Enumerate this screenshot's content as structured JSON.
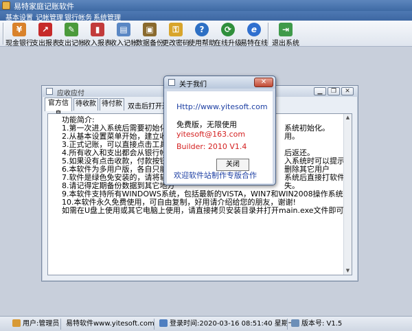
{
  "app": {
    "title": "易特家庭记账软件"
  },
  "menu": [
    "基本设置",
    "记帐管理",
    "银行帐务",
    "系统管理"
  ],
  "toolbar": [
    {
      "label": "现金银行",
      "icon": "cash-bank-icon",
      "color": "#d9822b",
      "glyph": "¥"
    },
    {
      "label": "支出报表",
      "icon": "expense-report-icon",
      "color": "#c62a2a",
      "glyph": "↗"
    },
    {
      "label": "支出记帐",
      "icon": "expense-entry-icon",
      "color": "#4b9a3c",
      "glyph": "✎"
    },
    {
      "label": "收入报表",
      "icon": "income-report-icon",
      "color": "#c23b3b",
      "glyph": "▮"
    },
    {
      "label": "收入记帐",
      "icon": "income-entry-icon",
      "color": "#5a87c4",
      "glyph": "▤"
    },
    {
      "label": "数据备份",
      "icon": "backup-icon",
      "color": "#8a6a2e",
      "glyph": "▣"
    },
    {
      "label": "更改密码",
      "icon": "key-icon",
      "color": "#d8a52c",
      "glyph": "⚿"
    },
    {
      "label": "使用帮助",
      "icon": "help-icon",
      "color": "#2c6fc4",
      "glyph": "?"
    },
    {
      "label": "在线升级",
      "icon": "online-upgrade-icon",
      "color": "#2f8f3c",
      "glyph": "⟳"
    },
    {
      "label": "易特在线",
      "icon": "browser-icon",
      "color": "#2f6fcf",
      "glyph": "e"
    },
    {
      "label": "退出系统",
      "icon": "exit-icon",
      "color": "#3f9a4a",
      "glyph": "⇥"
    }
  ],
  "child_window": {
    "title": "应收应付",
    "tabs": [
      "官方信息",
      "待收款",
      "待付款"
    ],
    "hint": "双击后打开进行",
    "lines": [
      "功能简介:",
      "1.第一次进入系统后需要初始化",
      "2.从基本设置菜单开始，建立收",
      "3.正式记账，可以直接点击工具",
      "4.所有收入和支出都会从银行帐",
      "5.如果没有点击收款，付款按钮",
      "6.本软件为多用户版，各自只能",
      "7.软件是绿色免安装的，请将软",
      "8.请记得定期备份数据到其它地方",
      "9.本软件支持所有WINDOWS系统，包括最新的VISTA，WIN7和WIN2008操作系统。",
      "10.本软件永久免费使用，可自由复制，好用请介绍给您的朋友，谢谢!",
      "如需在U盘上使用或其它电脑上使用，请直接拷贝安装目录并打开main.exe文件即可。"
    ],
    "right_fragments": [
      {
        "row": 1,
        "text": "系统初始化。"
      },
      {
        "row": 2,
        "text": "用。"
      },
      {
        "row": 4,
        "text": "后返还。"
      },
      {
        "row": 5,
        "text": "入系统时可以提示。"
      },
      {
        "row": 6,
        "text": "删除其它用户"
      },
      {
        "row": 7,
        "text": "系统后直接打软件可用。"
      },
      {
        "row": 8,
        "text": "失。"
      }
    ]
  },
  "dialog": {
    "title": "关于我们",
    "close_glyph": "✕",
    "url": "Http://www.yitesoft.com",
    "free": "免费版，无限使用",
    "email": "yitesoft@163.com",
    "builder": "Builder:  2010 V1.4",
    "button": "关闭",
    "slogan": "欢迎软件站制作专版合作",
    "colors": {
      "url": "#1d3fa3",
      "email": "#d42020",
      "slogan": "#1d3fa3"
    }
  },
  "status": {
    "user": "用户:管理员",
    "company": "易特软件www.yitesoft.com",
    "login": "登录时间:2020-03-16 08:51:40 星期一",
    "version": "版本号: V1.5"
  }
}
